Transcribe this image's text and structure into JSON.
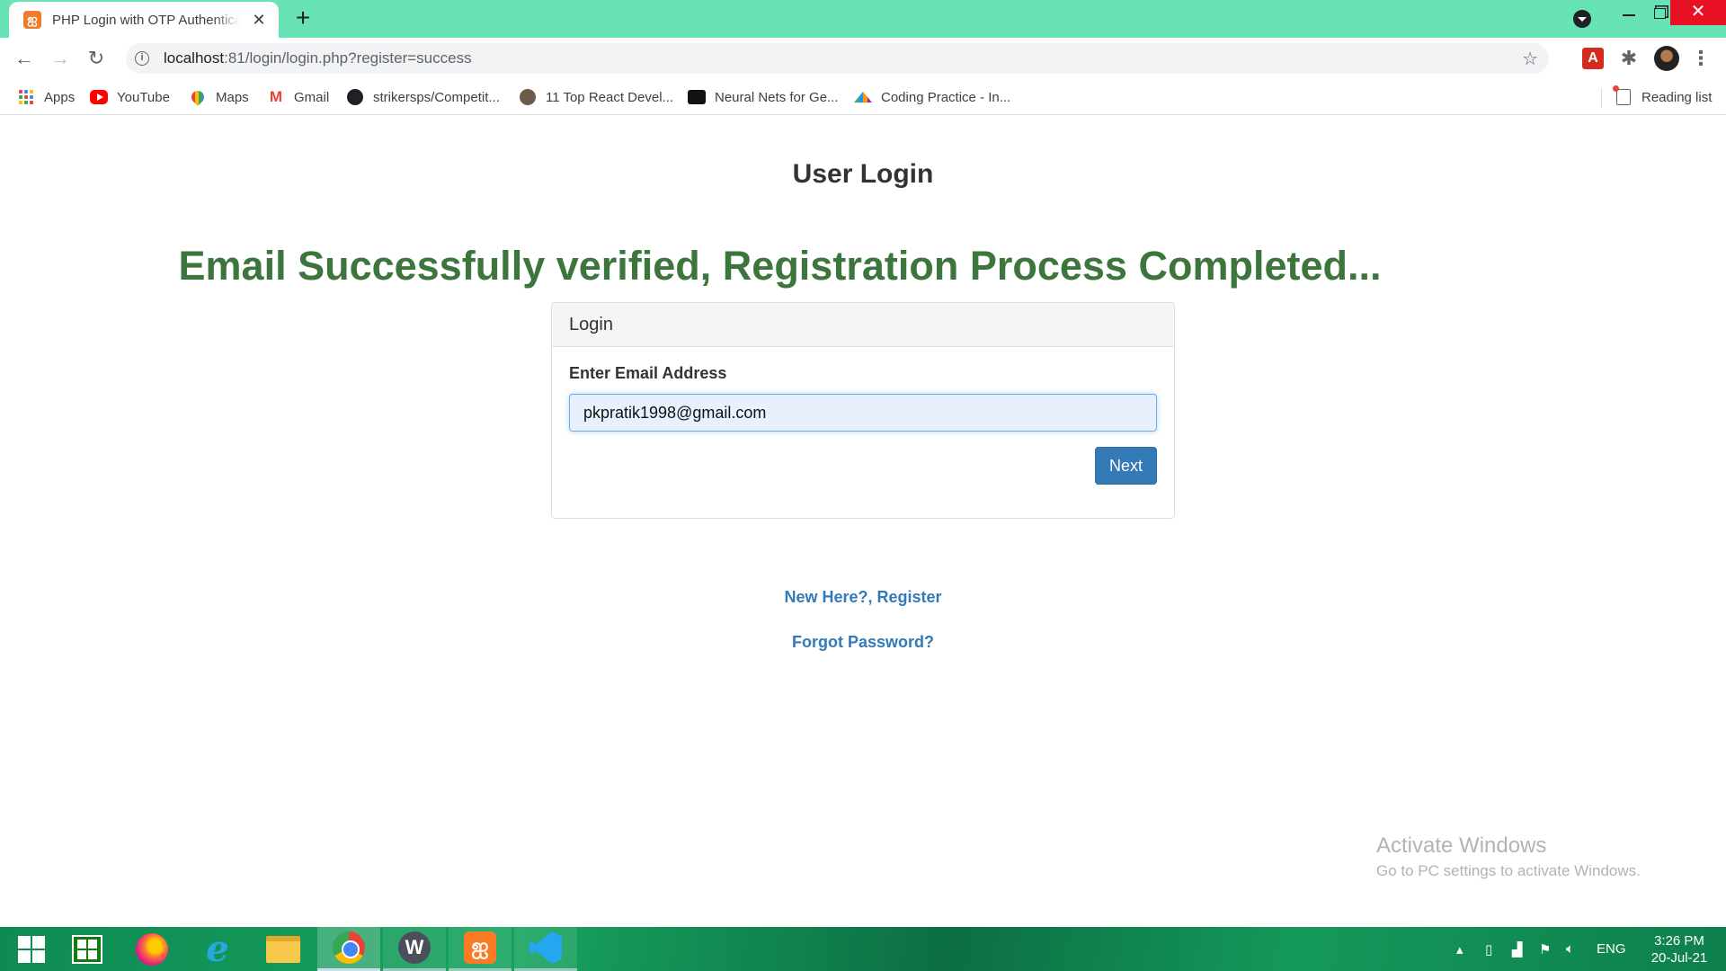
{
  "browser": {
    "tab_title": "PHP Login with OTP Authentication",
    "tab_favicon": "xampp-icon",
    "url_host": "localhost",
    "url_path": ":81/login/login.php?register=success"
  },
  "bookmarks": [
    {
      "label": "Apps",
      "icon": "apps-icon"
    },
    {
      "label": "YouTube",
      "icon": "youtube-icon"
    },
    {
      "label": "Maps",
      "icon": "maps-icon"
    },
    {
      "label": "Gmail",
      "icon": "gmail-icon"
    },
    {
      "label": "strikersps/Competit...",
      "icon": "github-icon"
    },
    {
      "label": "11 Top React Devel...",
      "icon": "avatar-icon"
    },
    {
      "label": "Neural Nets for Ge...",
      "icon": "video-icon"
    },
    {
      "label": "Coding Practice - In...",
      "icon": "coding-icon"
    }
  ],
  "reading_list": "Reading list",
  "page": {
    "title": "User Login",
    "success_message": "Email Successfully verified, Registration Process Completed...",
    "panel_heading": "Login",
    "email_label": "Enter Email Address",
    "email_value": "pkpratik1998@gmail.com",
    "next_button": "Next",
    "register_link": "New Here?, Register",
    "forgot_link": "Forgot Password?"
  },
  "watermark": {
    "title": "Activate Windows",
    "subtitle": "Go to PC settings to activate Windows."
  },
  "taskbar": {
    "language": "ENG",
    "time": "3:26 PM",
    "date": "20-Jul-21"
  },
  "colors": {
    "tab_strip": "#68e3b5",
    "success_text": "#3c763d",
    "primary_button": "#337ab7",
    "link": "#337ab7"
  }
}
